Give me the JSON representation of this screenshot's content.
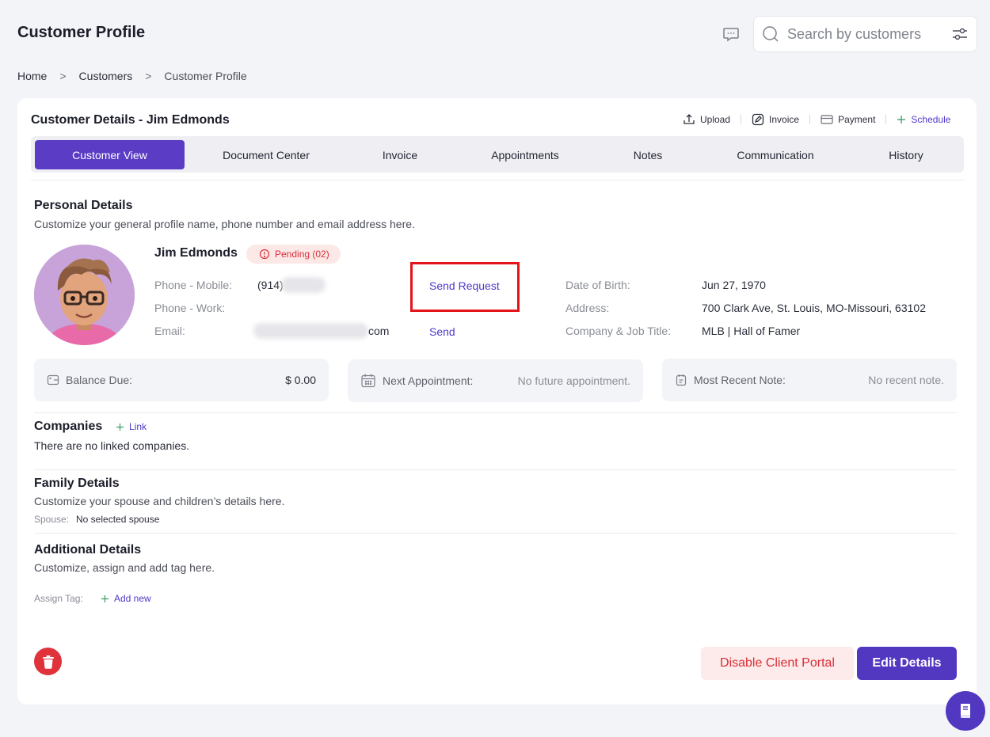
{
  "header": {
    "title": "Customer Profile",
    "search_placeholder": "Search by customers"
  },
  "breadcrumb": [
    "Home",
    "Customers",
    "Customer Profile"
  ],
  "card": {
    "title": "Customer Details - Jim Edmonds",
    "actions": {
      "upload": "Upload",
      "invoice": "Invoice",
      "payment": "Payment",
      "schedule": "Schedule"
    },
    "tabs": [
      "Customer View",
      "Document Center",
      "Invoice",
      "Appointments",
      "Notes",
      "Communication",
      "History"
    ]
  },
  "personal": {
    "title": "Personal Details",
    "subtitle": "Customize your general profile name, phone number and email address here.",
    "name": "Jim Edmonds",
    "pending": "Pending (02)",
    "phone_mobile_label": "Phone - Mobile:",
    "phone_mobile_value": "(914)",
    "phone_work_label": "Phone - Work:",
    "email_label": "Email:",
    "email_value": "com",
    "send_request": "Send Request",
    "send": "Send",
    "dob_label": "Date of Birth:",
    "dob_value": "Jun 27, 1970",
    "address_label": "Address:",
    "address_value": "700 Clark Ave, St. Louis, MO-Missouri, 63102",
    "company_label": "Company & Job Title:",
    "company_value": "MLB | Hall of Famer"
  },
  "info": {
    "balance_label": "Balance Due:",
    "balance_value": "$ 0.00",
    "appointment_label": "Next Appointment:",
    "appointment_value": "No future appointment.",
    "note_label": "Most Recent Note:",
    "note_value": "No recent note."
  },
  "companies": {
    "title": "Companies",
    "link": "Link",
    "empty": "There are no linked companies."
  },
  "family": {
    "title": "Family Details",
    "subtitle": "Customize your spouse and children’s details here.",
    "spouse_label": "Spouse:",
    "spouse_value": "No selected spouse"
  },
  "additional": {
    "title": "Additional Details",
    "subtitle": "Customize, assign and add tag here.",
    "tag_label": "Assign Tag:",
    "add_new": "Add new"
  },
  "buttons": {
    "disable_portal": "Disable Client Portal",
    "edit": "Edit Details"
  },
  "colors": {
    "primary": "#5237c0",
    "danger": "#e0323a",
    "highlight": "#e4141b"
  }
}
